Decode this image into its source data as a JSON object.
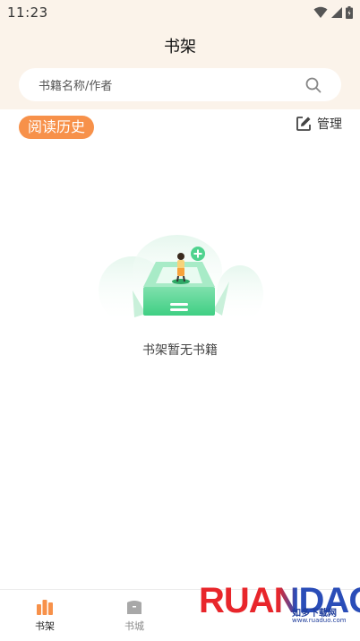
{
  "status_bar": {
    "time": "11:23",
    "icons": [
      "wifi-icon",
      "signal-icon",
      "battery-icon"
    ]
  },
  "header": {
    "title": "书架"
  },
  "search": {
    "placeholder": "书籍名称/作者",
    "icon": "search-icon"
  },
  "section": {
    "history_label": "阅读历史",
    "manage_label": "管理",
    "manage_icon": "edit-icon"
  },
  "empty_state": {
    "message": "书架暂无书籍"
  },
  "tabbar": {
    "tabs": [
      {
        "label": "书架",
        "icon": "bookshelf-icon",
        "active": true
      },
      {
        "label": "书城",
        "icon": "bookstore-icon",
        "active": false
      }
    ]
  },
  "watermark": {
    "brand": "RUANDAO",
    "subtitle": "如多下载网",
    "url": "www.ruaduo.com"
  },
  "colors": {
    "accent": "#f7914a",
    "header_bg": "#fbf3ea",
    "illustration_green": "#3fcf83"
  }
}
